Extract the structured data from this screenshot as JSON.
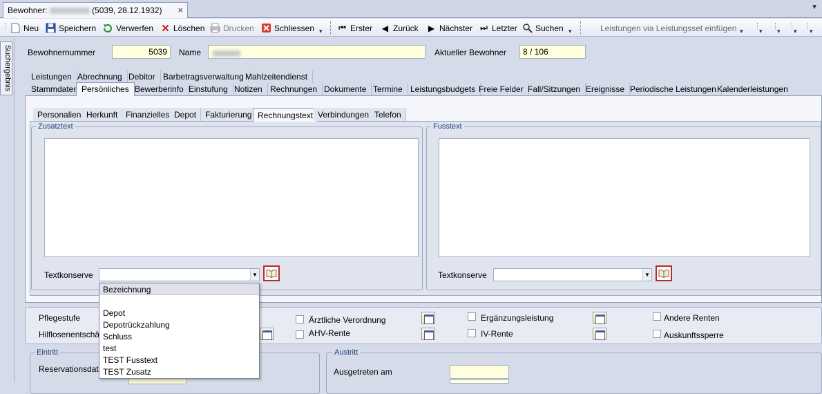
{
  "window": {
    "tab_prefix": "Bewohner:",
    "tab_suffix": "(5039, 28.12.1932)",
    "close_glyph": "×"
  },
  "toolbar": {
    "neu": "Neu",
    "speichern": "Speichern",
    "verwerfen": "Verwerfen",
    "loeschen": "Löschen",
    "drucken": "Drucken",
    "schliessen": "Schliessen",
    "erster": "Erster",
    "zurueck": "Zurück",
    "naechster": "Nächster",
    "letzter": "Letzter",
    "suchen": "Suchen",
    "leistungsset": "Leistungen via Leistungsset einfügen"
  },
  "side_tab": "Suchergebnis",
  "header": {
    "bewohnernummer_label": "Bewohnernummer",
    "bewohnernummer_value": "5039",
    "name_label": "Name",
    "aktuell_label": "Aktueller Bewohner",
    "aktuell_value": "8 / 106"
  },
  "main_tabs_row1": [
    "Leistungen",
    "Abrechnung",
    "Debitor",
    "Barbetragsverwaltung",
    "Mahlzeitendienst"
  ],
  "main_tabs_row2": [
    "Stammdaten",
    "Persönliches",
    "Bewerberinfo",
    "Einstufung",
    "Notizen",
    "Rechnungen",
    "Dokumente",
    "Termine",
    "Leistungsbudgets",
    "Freie Felder",
    "Fall/Sitzungen",
    "Ereignisse",
    "Periodische Leistungen",
    "Kalenderleistungen"
  ],
  "sub_tabs": [
    "Personalien",
    "Herkunft",
    "Finanzielles",
    "Depot",
    "Fakturierung",
    "Rechnungstext",
    "Verbindungen",
    "Telefon"
  ],
  "zusatztext": {
    "legend": "Zusatztext",
    "textkonserve_label": "Textkonserve"
  },
  "fusstext": {
    "legend": "Fusstext",
    "textkonserve_label": "Textkonserve"
  },
  "dropdown": {
    "header": "Bezeichnung",
    "options": [
      "",
      "Depot",
      "Depotrückzahlung",
      "Schluss",
      "test",
      "TEST Fusstext",
      "TEST Zusatz"
    ]
  },
  "lower": {
    "pflegestufe": "Pflegestufe",
    "hilflosen": "Hilflosenentschädi",
    "aerztliche": "Ärztliche Verordnung",
    "ahv": "AHV-Rente",
    "ergaenzung": "Ergänzungsleistung",
    "iv": "IV-Rente",
    "andere": "Andere Renten",
    "auskunft": "Auskunftssperre"
  },
  "eintritt": {
    "legend": "Eintritt",
    "reservation": "Reservationsdatum"
  },
  "austritt": {
    "legend": "Austritt",
    "ausgetreten": "Ausgetreten am"
  }
}
